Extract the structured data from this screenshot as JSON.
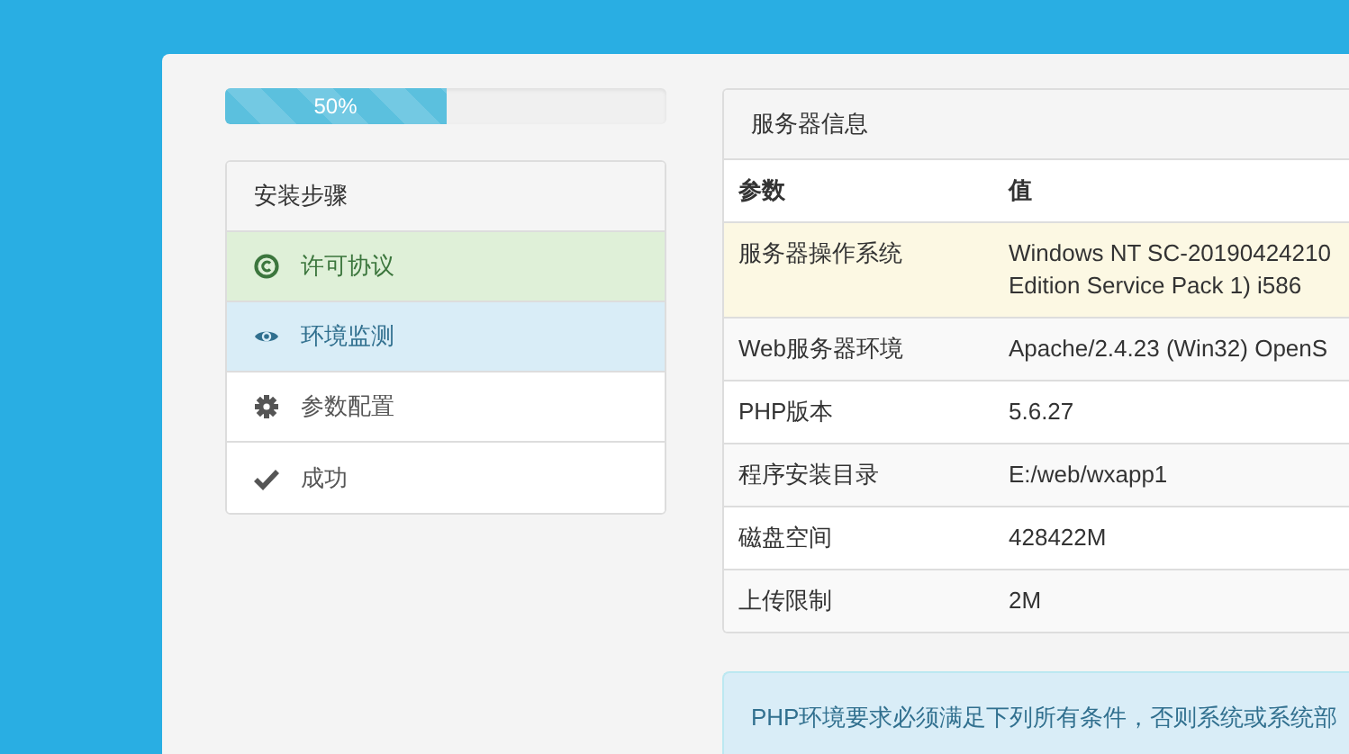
{
  "progress": {
    "label": "50%",
    "level": 0.5
  },
  "steps": {
    "title": "安装步骤",
    "items": [
      {
        "label": "许可协议",
        "kind": "done"
      },
      {
        "label": "环境监测",
        "kind": "current"
      },
      {
        "label": "参数配置",
        "kind": "todo"
      },
      {
        "label": "成功",
        "kind": "todo"
      }
    ]
  },
  "server_info": {
    "title": "服务器信息",
    "columns": [
      "参数",
      "值"
    ],
    "rows": [
      {
        "cells": [
          "服务器操作系统",
          "Windows NT SC-20190424210\nEdition Service Pack 1) i586"
        ],
        "highlighted": true
      },
      {
        "cells": [
          "Web服务器环境",
          "Apache/2.4.23 (Win32) OpenS"
        ],
        "highlighted": false
      },
      {
        "cells": [
          "PHP版本",
          "5.6.27"
        ],
        "highlighted": false
      },
      {
        "cells": [
          "程序安装目录",
          "E:/web/wxapp1"
        ],
        "highlighted": false
      },
      {
        "cells": [
          "磁盘空间",
          "428422M"
        ],
        "highlighted": false
      },
      {
        "cells": [
          "上传限制",
          "2M"
        ],
        "highlighted": false
      }
    ]
  },
  "notice": "PHP环境要求必须满足下列所有条件，否则系统或系统部"
}
